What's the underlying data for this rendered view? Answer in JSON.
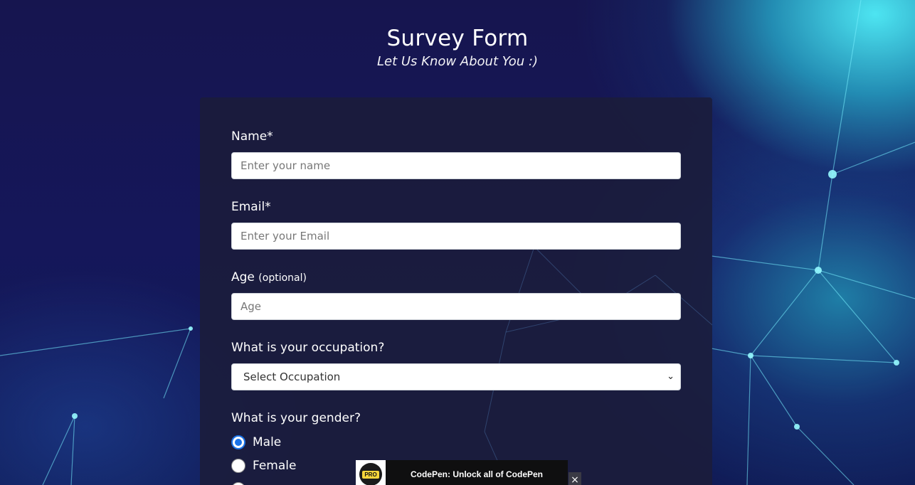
{
  "header": {
    "title": "Survey Form",
    "subtitle": "Let Us Know About You :)"
  },
  "form": {
    "name": {
      "label": "Name*",
      "placeholder": "Enter your name",
      "value": ""
    },
    "email": {
      "label": "Email*",
      "placeholder": "Enter your Email",
      "value": ""
    },
    "age": {
      "label": "Age",
      "label_note": "(optional)",
      "placeholder": "Age",
      "value": ""
    },
    "occupation": {
      "label": "What is your occupation?",
      "selected": "Select Occupation"
    },
    "gender": {
      "label": "What is your gender?",
      "options": [
        {
          "label": "Male",
          "checked": true
        },
        {
          "label": "Female",
          "checked": false
        }
      ]
    }
  },
  "promo": {
    "badge": "PRO",
    "text": "CodePen: Unlock all of CodePen",
    "close_label": "×"
  },
  "icons": {
    "select_chevron": "chevron-down-icon",
    "promo_logo": "pro-badge-icon",
    "close": "close-icon"
  },
  "colors": {
    "background": "#15175a",
    "card": "#1b1c3a",
    "accent_cyan": "#50f0fa",
    "radio_checked": "#1a73e8",
    "promo_badge": "#f7d53b"
  }
}
